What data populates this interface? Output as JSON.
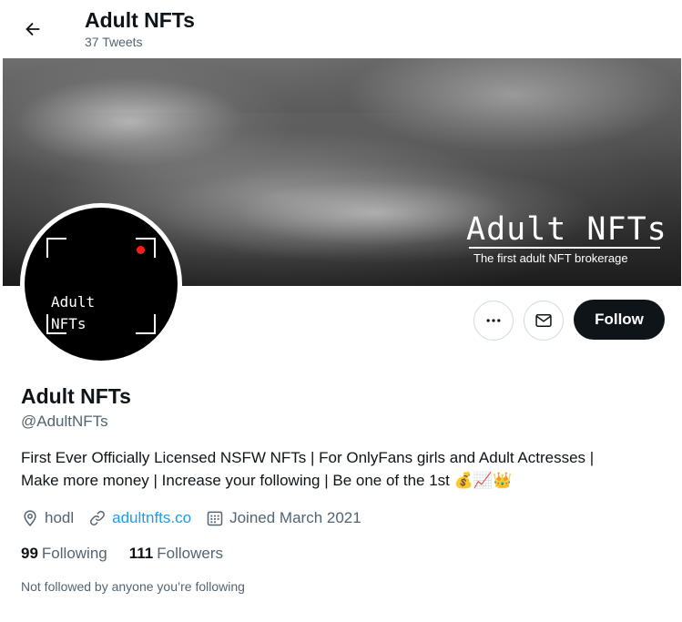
{
  "header": {
    "back_icon": "arrow-left-icon",
    "name": "Adult NFTs",
    "tweet_count": "37 Tweets"
  },
  "banner": {
    "logo_text": "Adult NFTs",
    "tagline": "The first adult NFT brokerage"
  },
  "avatar": {
    "text": "Adult\nNFTs",
    "dot_color": "#ff1a1a"
  },
  "actions": {
    "more_icon": "more-horizontal-icon",
    "message_icon": "envelope-icon",
    "follow_label": "Follow"
  },
  "profile": {
    "display_name": "Adult NFTs",
    "handle": "@AdultNFTs",
    "bio_line1": "First Ever Officially Licensed NSFW NFTs | For OnlyFans girls and Adult Actresses |",
    "bio_line2": "Make more money  | Increase your following  | Be one of the 1st ",
    "bio_emojis": "💰📈👑",
    "location": "hodl",
    "website": "adultnfts.co",
    "joined": "Joined March 2021"
  },
  "stats": {
    "following_count": "99",
    "following_label": "Following",
    "followers_count": "111",
    "followers_label": "Followers"
  },
  "footer_note": "Not followed by anyone you’re following",
  "colors": {
    "accent": "#1d9bf0",
    "text": "#0f1419",
    "secondary": "#536471",
    "follow_bg": "#0f1419"
  }
}
